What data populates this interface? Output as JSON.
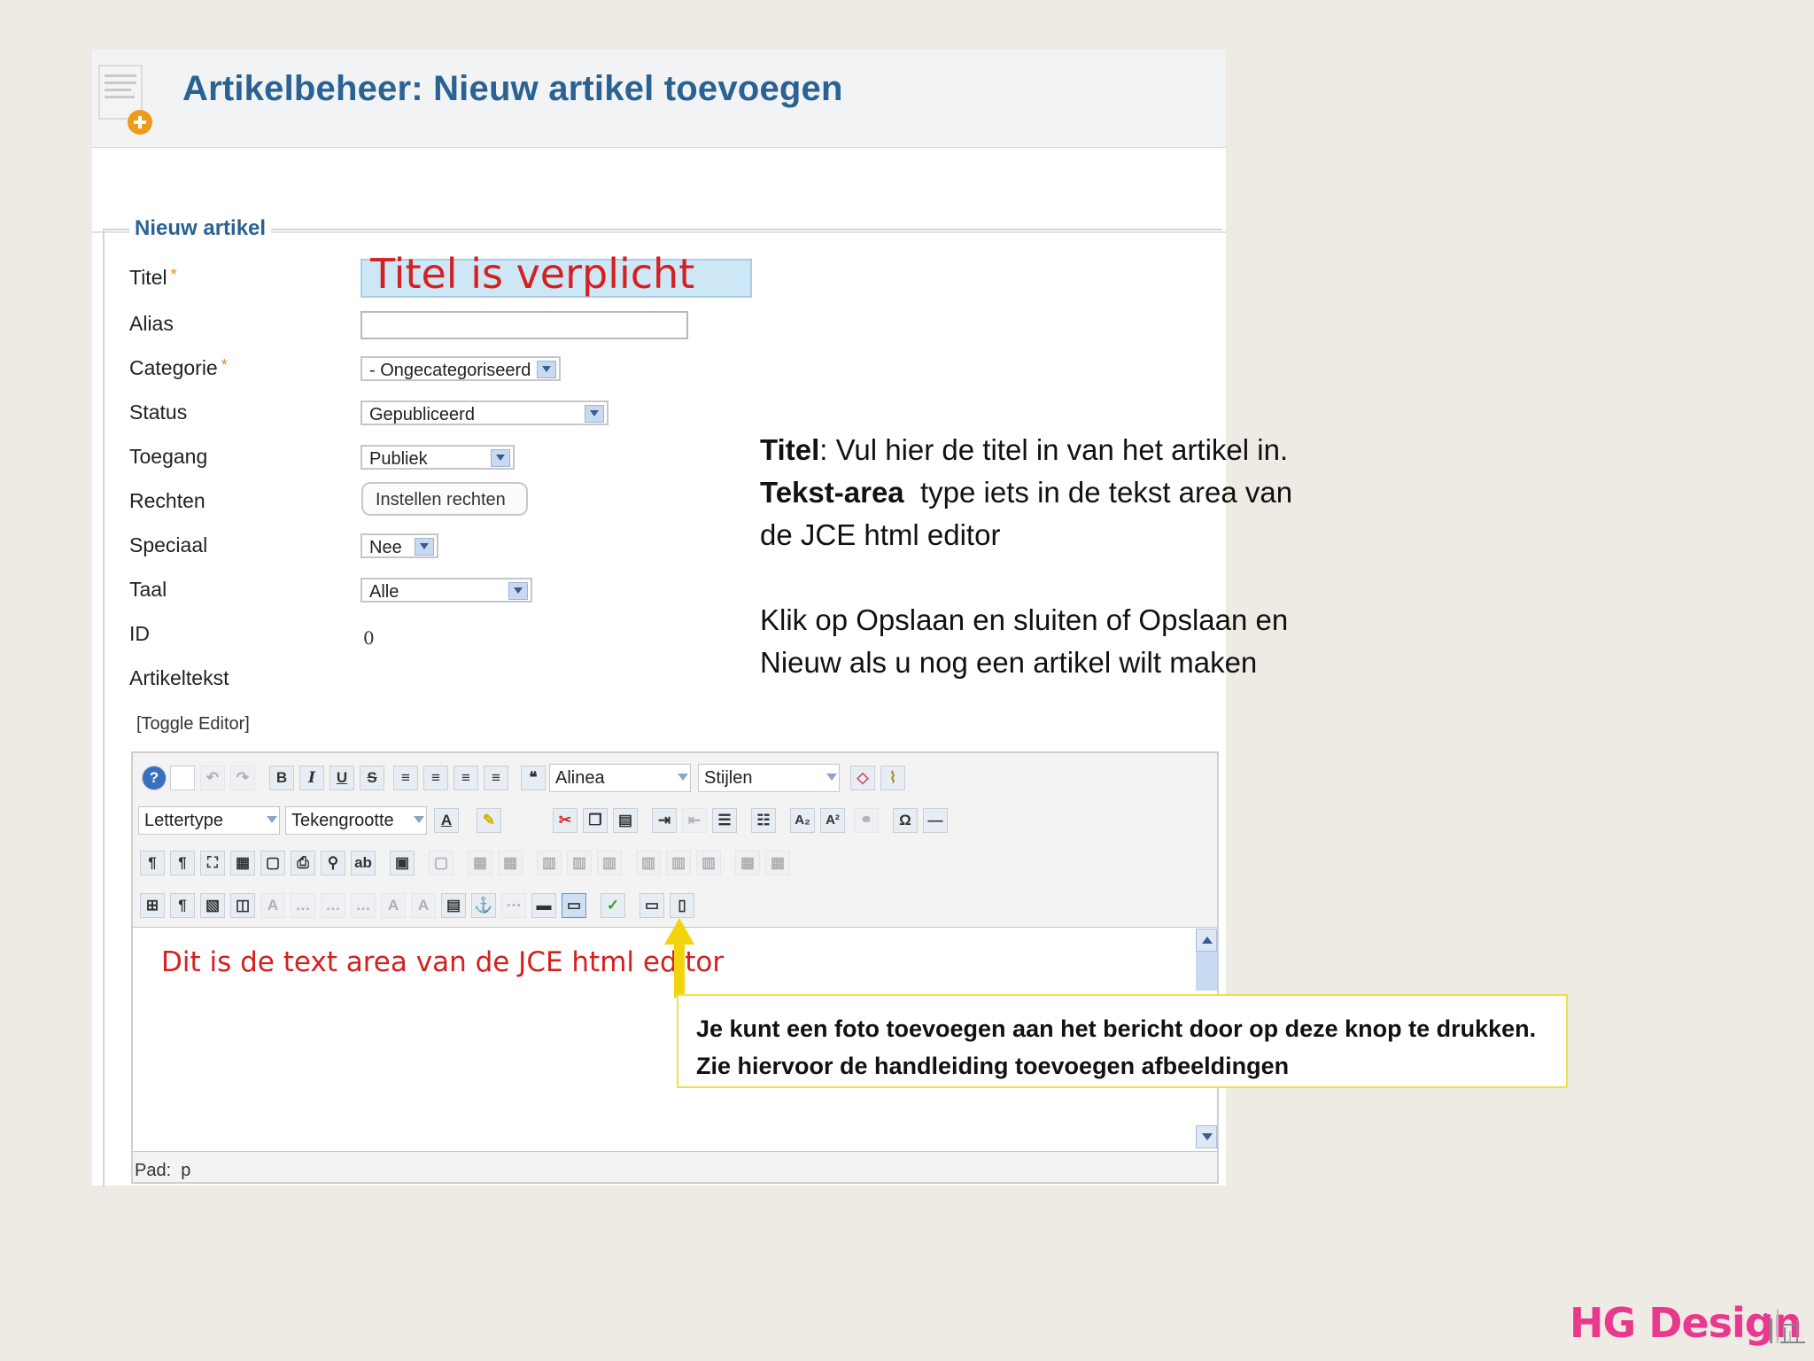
{
  "page": {
    "title": "Artikelbeheer: Nieuw artikel toevoegen"
  },
  "form": {
    "legend": "Nieuw artikel",
    "required_marker": "*",
    "fields": {
      "titel": {
        "label": "Titel",
        "value": "Titel is verplicht"
      },
      "alias": {
        "label": "Alias",
        "value": ""
      },
      "categorie": {
        "label": "Categorie",
        "value": "- Ongecategoriseerd"
      },
      "status": {
        "label": "Status",
        "value": "Gepubliceerd"
      },
      "toegang": {
        "label": "Toegang",
        "value": "Publiek"
      },
      "rechten": {
        "label": "Rechten",
        "button": "Instellen rechten"
      },
      "speciaal": {
        "label": "Speciaal",
        "value": "Nee"
      },
      "taal": {
        "label": "Taal",
        "value": "Alle"
      },
      "id": {
        "label": "ID",
        "value": "0"
      },
      "artikeltekst": {
        "label": "Artikeltekst"
      }
    }
  },
  "editor": {
    "toggle": "[Toggle Editor]",
    "format_select": "Alinea",
    "styles_select": "Stijlen",
    "font_select": "Lettertype",
    "size_select": "Tekengrootte",
    "content": "Dit is de text area van de JCE html editor",
    "path_label": "Pad:",
    "path_value": "p",
    "toolbar_row1_labels": [
      "B",
      "I",
      "U",
      "S"
    ],
    "subscript": "A₂",
    "superscript": "A²",
    "omega": "Ω",
    "quote": "❝"
  },
  "annotation": {
    "titel_bold": "Titel",
    "titel_text": ": Vul hier de titel in van het artikel in.",
    "tekst_bold": "Tekst-area",
    "tekst_text": "type iets in de tekst area van de JCE html editor",
    "line3": "Klik op Opslaan en sluiten of Opslaan en Nieuw als u nog een artikel wilt maken"
  },
  "callout": {
    "text": "Je kunt een foto toevoegen aan het bericht door op deze knop te drukken. Zie hiervoor de handleiding toevoegen afbeeldingen"
  },
  "brand": {
    "name": "HG Design",
    "color": "#e8398f"
  },
  "colors": {
    "heading_blue": "#2a6293",
    "required_text_red": "#d42020",
    "callout_yellow": "#f2d40c"
  }
}
